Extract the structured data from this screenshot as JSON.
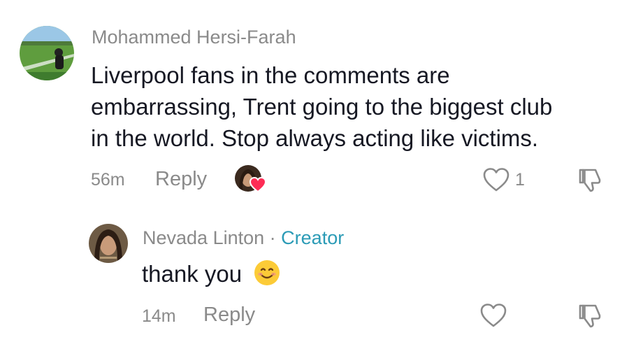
{
  "comments": [
    {
      "username": "Mohammed Hersi-Farah",
      "text_lines": [
        "Liverpool fans in the comments are",
        "embarrassing, Trent going to the biggest club",
        "in the world. Stop always acting like victims."
      ],
      "time": "56m",
      "reply_label": "Reply",
      "likes": "1",
      "liked_by_creator": true
    }
  ],
  "reply": {
    "username": "Nevada Linton",
    "separator": "·",
    "badge": "Creator",
    "text": "thank you",
    "emoji": "smiling-face-emoji",
    "time": "14m",
    "reply_label": "Reply"
  },
  "colors": {
    "text": "#161823",
    "muted": "#8a8a8a",
    "creator_badge": "#2b9bb6",
    "heart_badge": "#fe2c55"
  },
  "icons": [
    "heart-outline-icon",
    "thumbs-down-icon",
    "heart-badge-icon"
  ]
}
